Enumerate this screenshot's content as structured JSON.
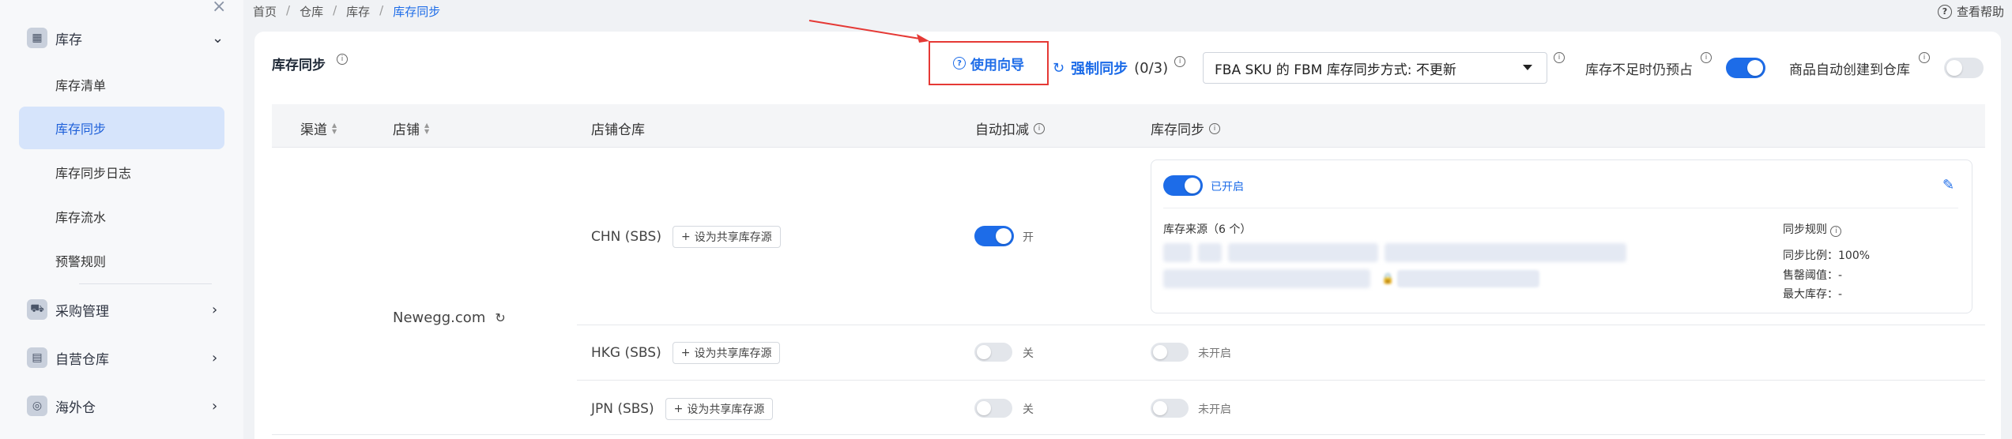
{
  "sidebar": {
    "close_glyph": "×",
    "groups": [
      {
        "label": "库存",
        "icon": "warehouse-icon",
        "expanded": true
      },
      {
        "label": "采购管理",
        "icon": "purchase-cart-icon",
        "expanded": false
      },
      {
        "label": "自营仓库",
        "icon": "own-warehouse-icon",
        "expanded": false
      },
      {
        "label": "海外仓",
        "icon": "globe-warehouse-icon",
        "expanded": false
      }
    ],
    "items": [
      {
        "label": "库存清单",
        "active": false
      },
      {
        "label": "库存同步",
        "active": true
      },
      {
        "label": "库存同步日志",
        "active": false
      },
      {
        "label": "库存流水",
        "active": false
      },
      {
        "label": "预警规则",
        "active": false
      }
    ]
  },
  "breadcrumb": {
    "items": [
      "首页",
      "仓库",
      "库存",
      "库存同步"
    ],
    "separator": "/"
  },
  "help": {
    "label": "查看帮助"
  },
  "page": {
    "title": "库存同步"
  },
  "toolbar": {
    "guide_label": "使用向导",
    "force_sync_label": "强制同步",
    "force_sync_count": "(0/3)",
    "fba_select_value": "FBA SKU 的 FBM 库存同步方式: 不更新",
    "preoccupy_label": "库存不足时仍预占",
    "preoccupy_on": true,
    "auto_create_label": "商品自动创建到仓库",
    "auto_create_on": false
  },
  "table": {
    "headers": [
      "渠道",
      "店铺",
      "店铺仓库",
      "自动扣减",
      "库存同步"
    ],
    "store": "Newegg.com",
    "rows": [
      {
        "warehouse": "CHN (SBS)",
        "share_label": "设为共享库存源",
        "auto_deduct_on": true,
        "auto_deduct_label": "开",
        "sync_on": true,
        "sync_label": "已开启",
        "source_title": "库存来源（6 个）",
        "rules_title": "同步规则",
        "ratio": "同步比例：100%",
        "alert": "售罄阈值：-",
        "max": "最大库存：-"
      },
      {
        "warehouse": "HKG (SBS)",
        "share_label": "设为共享库存源",
        "auto_deduct_on": false,
        "auto_deduct_label": "关",
        "sync_on": false,
        "sync_label": "未开启"
      },
      {
        "warehouse": "JPN (SBS)",
        "share_label": "设为共享库存源",
        "auto_deduct_on": false,
        "auto_deduct_label": "关",
        "sync_on": false,
        "sync_label": "未开启"
      }
    ]
  },
  "colors": {
    "accent": "#1d6ce8",
    "highlight": "#e53935",
    "active_bg": "#d6e4fb"
  }
}
